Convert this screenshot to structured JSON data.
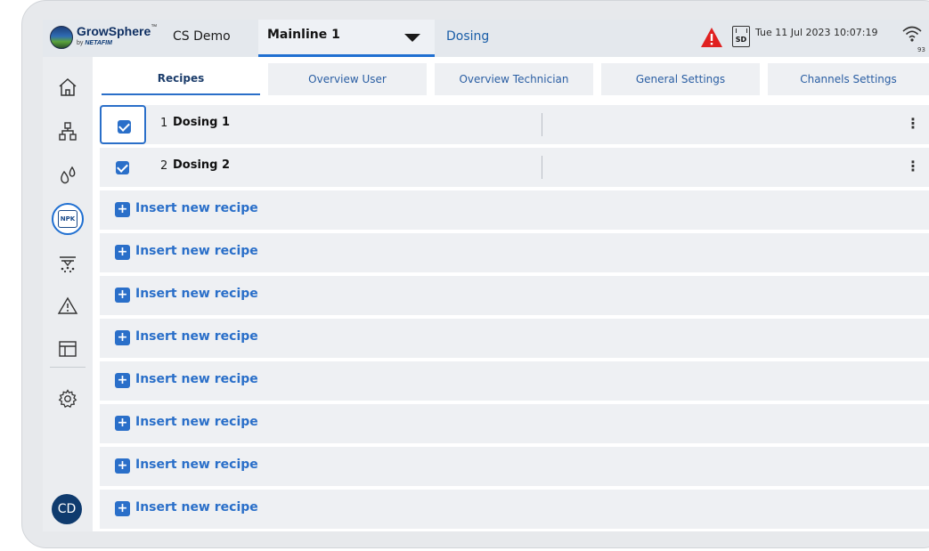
{
  "header": {
    "logo_main": "GrowSphere",
    "logo_tm": "™",
    "logo_sub_prefix": "by",
    "logo_sub_brand": "NETAFIM",
    "site_name": "CS Demo",
    "mainline": "Mainline 1",
    "module": "Dosing",
    "sd_label": "SD",
    "datetime": "Tue 11 Jul 2023   10:07:19",
    "wifi_value": "93",
    "alert_color": "#e02020"
  },
  "sidebar": {
    "items": [
      {
        "icon": "home-icon"
      },
      {
        "icon": "hierarchy-icon"
      },
      {
        "icon": "water-drops-icon"
      },
      {
        "icon": "npk-icon",
        "label": "NPK",
        "active": true
      },
      {
        "icon": "irrigation-icon"
      },
      {
        "icon": "warning-icon"
      },
      {
        "icon": "table-icon"
      },
      {
        "icon": "settings-icon"
      }
    ],
    "avatar": "CD"
  },
  "tabs": [
    {
      "label": "Recipes",
      "active": true
    },
    {
      "label": "Overview User"
    },
    {
      "label": "Overview Technician"
    },
    {
      "label": "General Settings"
    },
    {
      "label": "Channels Settings"
    }
  ],
  "recipes": [
    {
      "num": "1",
      "name": "Dosing 1",
      "checked": true
    },
    {
      "num": "2",
      "name": "Dosing 2",
      "checked": true
    }
  ],
  "insert_rows": [
    {
      "label": "Insert new recipe"
    },
    {
      "label": "Insert new recipe"
    },
    {
      "label": "Insert new recipe"
    },
    {
      "label": "Insert new recipe"
    },
    {
      "label": "Insert new recipe"
    },
    {
      "label": "Insert new recipe"
    },
    {
      "label": "Insert new recipe"
    },
    {
      "label": "Insert new recipe"
    }
  ],
  "row_menu_glyph": "⋮",
  "insert_plus_glyph": "+",
  "colors": {
    "accent": "#2a6fc9",
    "topbar": "#e4e8ed",
    "avatar": "#0f3b6e"
  }
}
